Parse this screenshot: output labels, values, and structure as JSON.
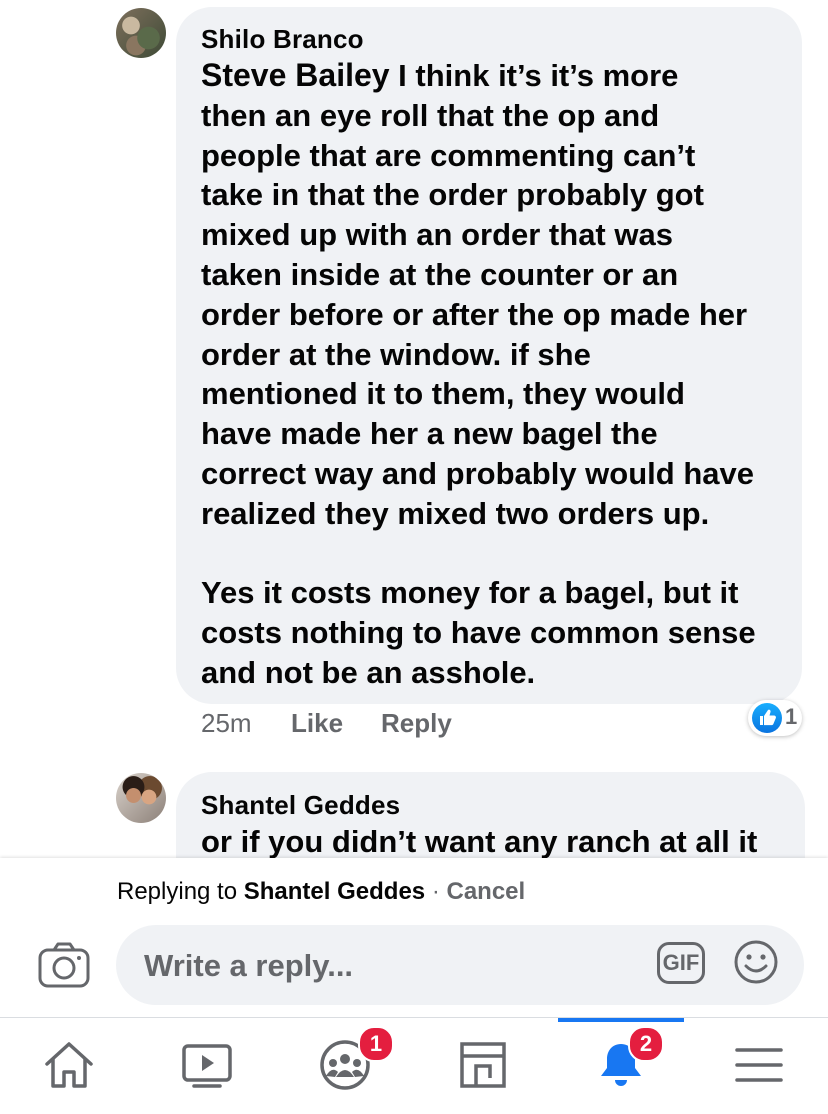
{
  "comments": [
    {
      "author": "Shilo Branco",
      "tag": "Steve Bailey",
      "lines": [
        " I think it’s it’s more",
        "then an eye roll that the op and",
        "people that are commenting can’t",
        "take in that the order probably got",
        "mixed up with an order that was",
        "taken inside at the counter or an",
        "order before or after the op made her",
        "order at the window. if she",
        "mentioned it to them, they would",
        "have made her a new bagel the",
        "correct way and probably would have",
        "realized they mixed two orders up.",
        "",
        "Yes it costs money for a bagel, but it",
        "costs nothing to have common sense",
        "and not be an asshole."
      ],
      "time": "25m",
      "like_label": "Like",
      "reply_label": "Reply",
      "reaction_count": "1"
    },
    {
      "author": "Shantel Geddes",
      "text_line": "or if you didn’t want any ranch at all it"
    }
  ],
  "reply_panel": {
    "replying_prefix": "Replying to",
    "replying_name": "Shantel Geddes",
    "separator": "·",
    "cancel_label": "Cancel",
    "placeholder": "Write a reply...",
    "gif_label": "GIF"
  },
  "tabbar": {
    "tabs": [
      {
        "icon": "home-icon"
      },
      {
        "icon": "watch-icon"
      },
      {
        "icon": "groups-icon",
        "badge": "1"
      },
      {
        "icon": "marketplace-icon"
      },
      {
        "icon": "notifications-icon",
        "badge": "2",
        "active": true
      },
      {
        "icon": "menu-icon"
      }
    ]
  },
  "colors": {
    "accent": "#1877f2",
    "bubble": "#f0f2f5",
    "secondary_text": "#65676b",
    "badge": "#e41e3f"
  }
}
